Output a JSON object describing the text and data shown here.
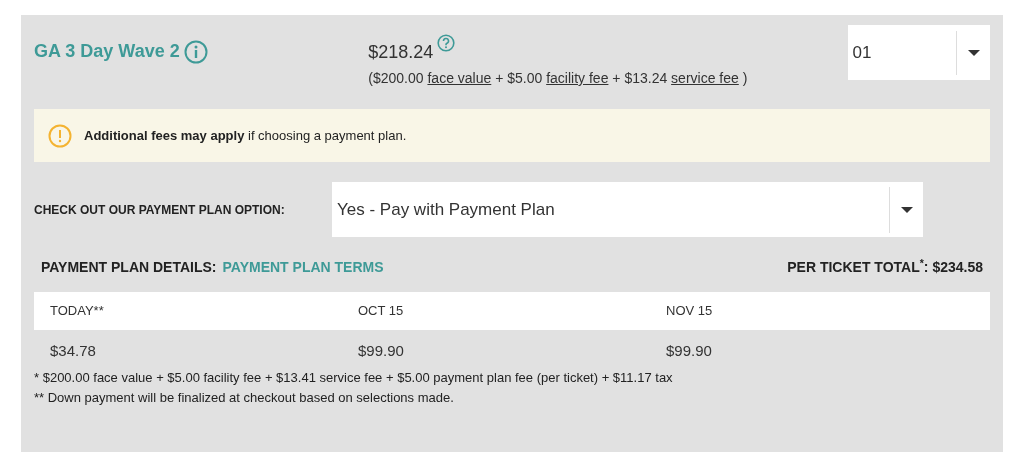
{
  "ticket": {
    "name": "GA 3 Day Wave 2",
    "price": "$218.24",
    "breakdown": [
      {
        "amount": "($200.00",
        "link": "face value"
      },
      {
        "amount": "+ $5.00",
        "link": "facility fee"
      },
      {
        "amount": "+ $13.24",
        "link": "service fee"
      }
    ],
    "breakdown_close": ")",
    "quantity": "01"
  },
  "notice": {
    "text": "**Additional fees may apply** if choosing a payment plan."
  },
  "payment_plan_option": {
    "label": "CHECK OUT OUR PAYMENT PLAN OPTION:",
    "value": "Yes - Pay with Payment Plan"
  },
  "details": {
    "label": "PAYMENT PLAN DETAILS:",
    "link": "PAYMENT PLAN TERMS",
    "total": "PER TICKET TOTAL$^{*}$: $234.58"
  },
  "schedule": [
    {
      "date": "TODAY**",
      "amount": "$34.78"
    },
    {
      "date": "OCT 15",
      "amount": "$99.90"
    },
    {
      "date": "NOV 15",
      "amount": "$99.90"
    }
  ],
  "footnotes": [
    "* $200.00 face value + $5.00 facility fee + $13.41 service fee + $5.00 payment plan fee (per ticket) + $11.17 tax",
    "** Down payment will be finalized at checkout based on selections made."
  ]
}
